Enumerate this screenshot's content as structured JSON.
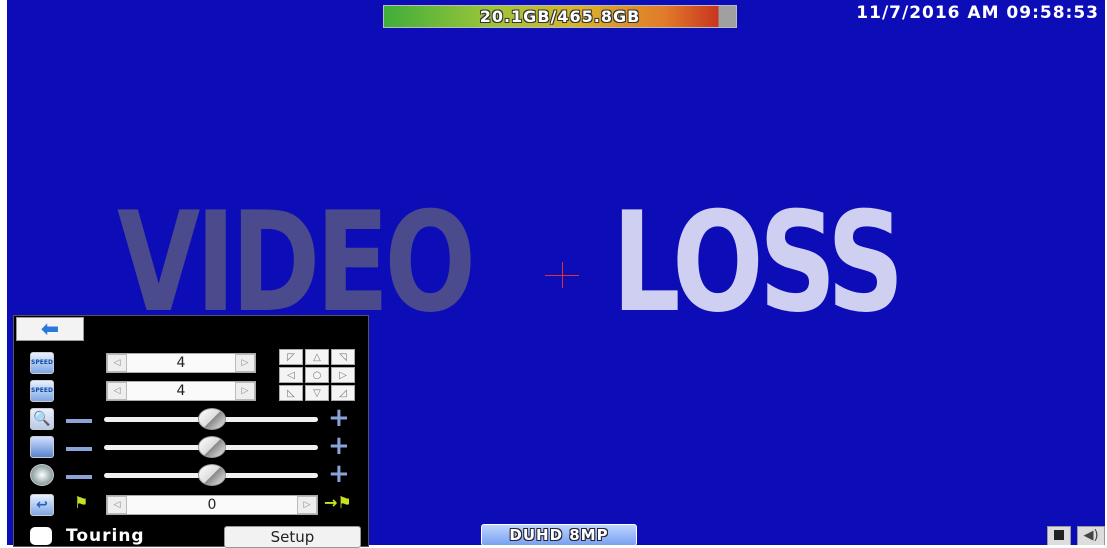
{
  "status_bar": {
    "storage_text": "20.1GB/465.8GB",
    "storage_used_fraction": 0.95,
    "datetime": "11/7/2016 AM 09:58:53"
  },
  "video": {
    "loss_word_1": "VIDEO",
    "loss_word_2": "LOSS"
  },
  "ptz_panel": {
    "back_icon": "left-arrow-icon",
    "speed_icon_label": "SPEED",
    "pt_speed_icon_label": "SPEED",
    "speed_value": "4",
    "pt_speed_value": "4",
    "zoom_icon": "magnifier-icon",
    "focus_icon": "focus-icon",
    "iris_icon": "iris-icon",
    "preset_icon": "return-arrow-icon",
    "preset_value": "0",
    "touring_label": "Touring",
    "setup_label": "Setup",
    "dpad": [
      "◸",
      "△",
      "◹",
      "◁",
      "○",
      "▷",
      "◺",
      "▽",
      "◿"
    ]
  },
  "bottom_bar": {
    "resolution_badge": "DUHD 8MP",
    "hdd_icon": "hdd-icon",
    "speaker_icon": "speaker-icon"
  },
  "colors": {
    "screen_bg": "#0d0db8",
    "video_word_1": "#4a4a8c",
    "video_word_2": "#cfcff2"
  }
}
